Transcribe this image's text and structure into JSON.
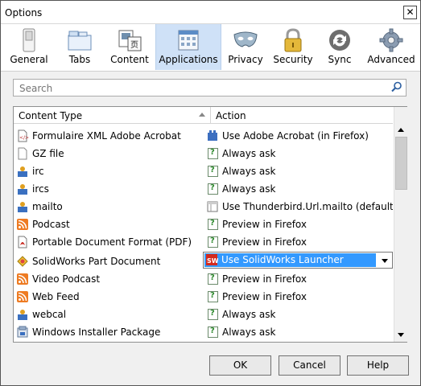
{
  "window": {
    "title": "Options",
    "close_glyph": "✕"
  },
  "toolbar": [
    {
      "label": "General",
      "icon": "general-switch-icon",
      "selected": false
    },
    {
      "label": "Tabs",
      "icon": "tabs-icon",
      "selected": false
    },
    {
      "label": "Content",
      "icon": "content-icon",
      "selected": false
    },
    {
      "label": "Applications",
      "icon": "applications-icon",
      "selected": true
    },
    {
      "label": "Privacy",
      "icon": "privacy-mask-icon",
      "selected": false
    },
    {
      "label": "Security",
      "icon": "security-lock-icon",
      "selected": false
    },
    {
      "label": "Sync",
      "icon": "sync-icon",
      "selected": false
    },
    {
      "label": "Advanced",
      "icon": "advanced-gear-icon",
      "selected": false
    }
  ],
  "search": {
    "placeholder": "Search",
    "value": ""
  },
  "table": {
    "headers": {
      "type": "Content Type",
      "action": "Action"
    },
    "rows": [
      {
        "type": "Formulaire XML Adobe Acrobat",
        "type_icon": "xml-doc-icon",
        "action": "Use Adobe Acrobat (in Firefox)",
        "action_icon": "plugin-icon"
      },
      {
        "type": "GZ file",
        "type_icon": "blank-doc-icon",
        "action": "Always ask",
        "action_icon": "ask-icon"
      },
      {
        "type": "irc",
        "type_icon": "app-icon",
        "action": "Always ask",
        "action_icon": "ask-icon"
      },
      {
        "type": "ircs",
        "type_icon": "app-icon",
        "action": "Always ask",
        "action_icon": "ask-icon"
      },
      {
        "type": "mailto",
        "type_icon": "app-icon",
        "action": "Use Thunderbird.Url.mailto (default)",
        "action_icon": "window-icon"
      },
      {
        "type": "Podcast",
        "type_icon": "feed-icon",
        "action": "Preview in Firefox",
        "action_icon": "ask-icon"
      },
      {
        "type": "Portable Document Format (PDF)",
        "type_icon": "pdf-icon",
        "action": "Preview in Firefox",
        "action_icon": "ask-icon"
      },
      {
        "type": "SolidWorks Part Document",
        "type_icon": "solidworks-part-icon",
        "action": "Use SolidWorks Launcher",
        "action_icon": "solidworks-icon",
        "selected": true
      },
      {
        "type": "Video Podcast",
        "type_icon": "feed-icon",
        "action": "Preview in Firefox",
        "action_icon": "ask-icon"
      },
      {
        "type": "Web Feed",
        "type_icon": "feed-icon",
        "action": "Preview in Firefox",
        "action_icon": "ask-icon"
      },
      {
        "type": "webcal",
        "type_icon": "app-icon",
        "action": "Always ask",
        "action_icon": "ask-icon"
      },
      {
        "type": "Windows Installer Package",
        "type_icon": "installer-icon",
        "action": "Always ask",
        "action_icon": "ask-icon"
      }
    ]
  },
  "buttons": {
    "ok": "OK",
    "cancel": "Cancel",
    "help": "Help"
  }
}
